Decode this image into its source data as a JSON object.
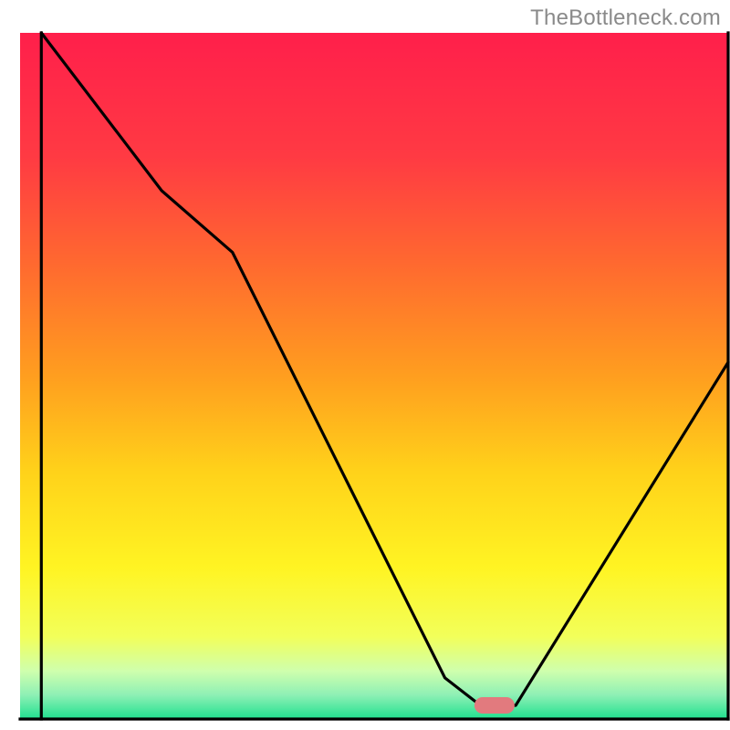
{
  "watermark": "TheBottleneck.com",
  "chart_data": {
    "type": "line",
    "title": "",
    "xlabel": "",
    "ylabel": "",
    "xlim": [
      0,
      100
    ],
    "ylim": [
      0,
      100
    ],
    "series": [
      {
        "name": "curve",
        "x": [
          3,
          20,
          30,
          60,
          65,
          70,
          100
        ],
        "y": [
          100,
          77,
          68,
          6,
          2,
          2,
          52
        ]
      }
    ],
    "highlight_marker": {
      "x": 67,
      "y": 2,
      "color": "#e27a7e"
    },
    "gradient_stops": [
      {
        "t": 0.0,
        "color": "#ff1f4b"
      },
      {
        "t": 0.18,
        "color": "#ff3a43"
      },
      {
        "t": 0.34,
        "color": "#ff6a2f"
      },
      {
        "t": 0.5,
        "color": "#ff9e1f"
      },
      {
        "t": 0.64,
        "color": "#ffd21a"
      },
      {
        "t": 0.78,
        "color": "#fff423"
      },
      {
        "t": 0.88,
        "color": "#f2ff5a"
      },
      {
        "t": 0.93,
        "color": "#cfffad"
      },
      {
        "t": 0.965,
        "color": "#8ef0b5"
      },
      {
        "t": 1.0,
        "color": "#1fe08f"
      }
    ],
    "axes": {
      "left": {
        "from": [
          3,
          0
        ],
        "to": [
          3,
          100
        ]
      },
      "bottom": {
        "from": [
          0,
          0
        ],
        "to": [
          100,
          0
        ]
      },
      "right": {
        "from": [
          100,
          0
        ],
        "to": [
          100,
          100
        ]
      }
    }
  }
}
